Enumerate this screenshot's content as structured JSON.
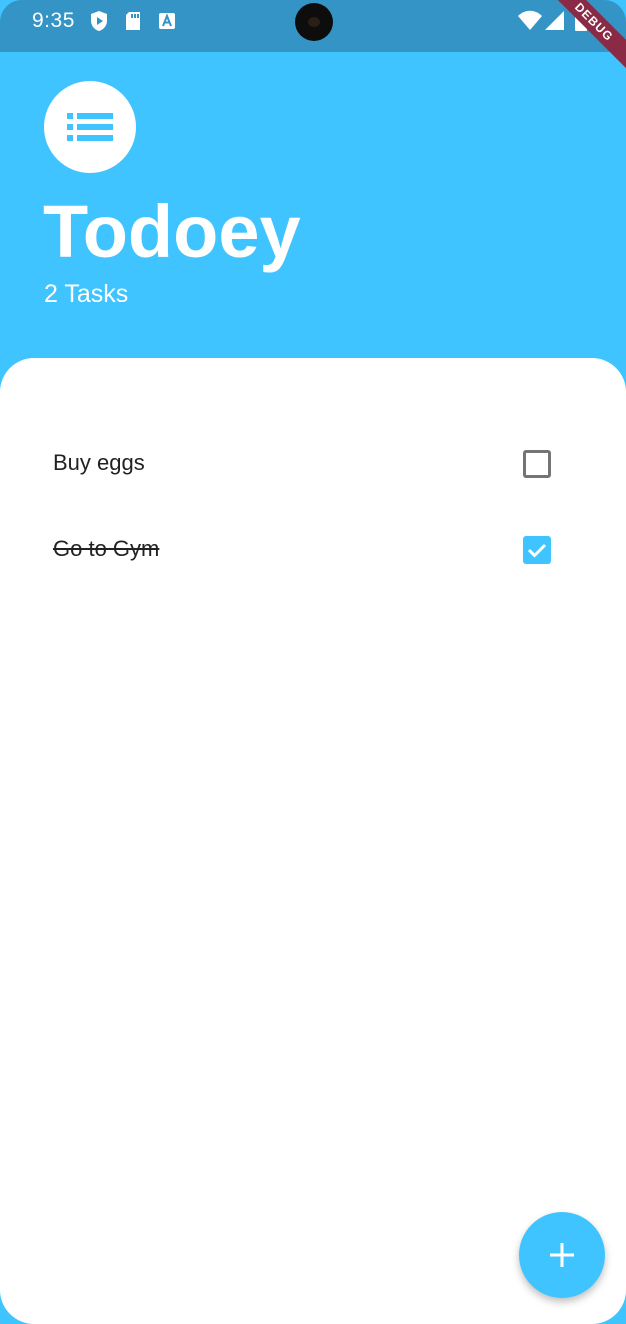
{
  "status_bar": {
    "time": "9:35",
    "icons": [
      "shield-play-icon",
      "sd-card-icon",
      "font-a-icon",
      "wifi-icon",
      "signal-icon",
      "battery-icon"
    ],
    "debug_banner": "DEBUG"
  },
  "header": {
    "logo_icon": "list-icon",
    "title": "Todoey",
    "task_count": "2 Tasks"
  },
  "tasks": [
    {
      "label": "Buy eggs",
      "done": false
    },
    {
      "label": "Go to Gym",
      "done": true
    }
  ],
  "fab": {
    "icon": "plus-icon"
  },
  "colors": {
    "accent": "#40C4FF",
    "status_bar": "#3494C5",
    "debug_banner": "#8B2A45"
  }
}
